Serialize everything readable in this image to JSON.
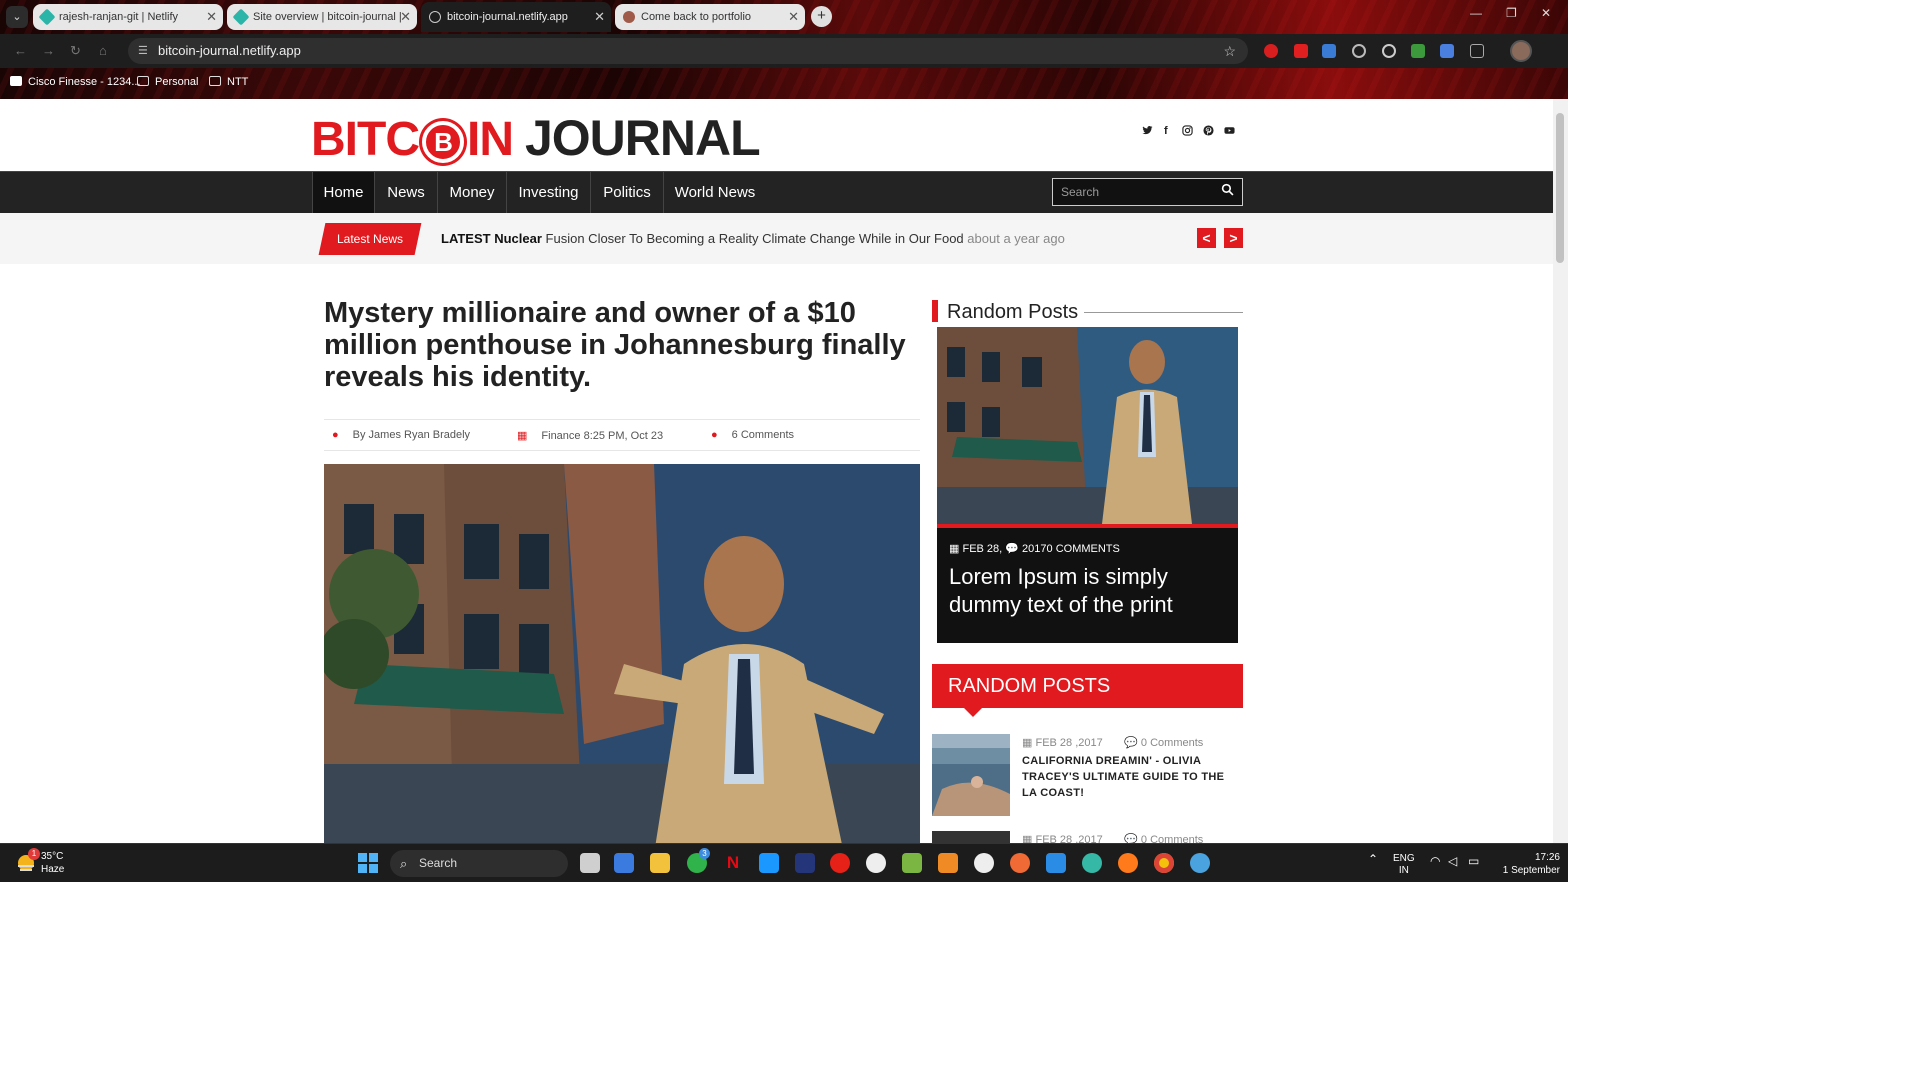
{
  "browser": {
    "tabs": [
      {
        "title": "rajesh-ranjan-git | Netlify",
        "active": false
      },
      {
        "title": "Site overview | bitcoin-journal |",
        "active": false
      },
      {
        "title": "bitcoin-journal.netlify.app",
        "active": true
      },
      {
        "title": "Come back to portfolio",
        "active": false
      }
    ],
    "new_tab": "+",
    "url": "bitcoin-journal.netlify.app",
    "bookmarks": [
      {
        "label": "Cisco Finesse - 1234..."
      },
      {
        "label": "Personal"
      },
      {
        "label": "NTT"
      }
    ]
  },
  "site": {
    "logo_left": "BITC",
    "logo_coin": "B",
    "logo_mid": "IN",
    "logo_right": "JOURNAL",
    "social": [
      "twitter-icon",
      "facebook-icon",
      "instagram-icon",
      "pinterest-icon",
      "youtube-icon"
    ],
    "nav": [
      "Home",
      "News",
      "Money",
      "Investing",
      "Politics",
      "World News"
    ],
    "search_placeholder": "Search"
  },
  "ticker": {
    "badge": "Latest News",
    "prefix": "LATEST",
    "bold": "Nuclear",
    "text": "Fusion Closer To Becoming a Reality Climate Change While in Our Food",
    "ago": "about a year ago",
    "prev": "<",
    "next": ">"
  },
  "article": {
    "headline": "Mystery millionaire and owner of a $10 million penthouse in Johannesburg finally reveals his identity.",
    "author": "By James Ryan Bradely",
    "category_date": "Finance 8:25 PM, Oct 23",
    "comments": "6 Comments"
  },
  "sidebar": {
    "random_posts_title": "Random Posts",
    "featured": {
      "date": "FEB 28,",
      "comments": "20170 COMMENTS",
      "title": "Lorem Ipsum is simply dummy text of the print"
    },
    "random_posts_header": "RANDOM POSTS",
    "posts": [
      {
        "date": "FEB 28 ,2017",
        "comments": "0 Comments",
        "title": "CALIFORNIA DREAMIN' - OLIVIA TRACEY'S ULTIMATE GUIDE TO THE LA COAST!"
      },
      {
        "date": "FEB 28 ,2017",
        "comments": "0 Comments",
        "title": ""
      }
    ]
  },
  "taskbar": {
    "temperature": "35°C",
    "condition": "Haze",
    "weather_badge": "1",
    "search_label": "Search",
    "whatsapp_badge": "3",
    "lang_top": "ENG",
    "lang_bottom": "IN",
    "time": "17:26",
    "date": "1 September"
  },
  "colors": {
    "brand_red": "#e01a1f",
    "nav_dark": "#232323"
  }
}
